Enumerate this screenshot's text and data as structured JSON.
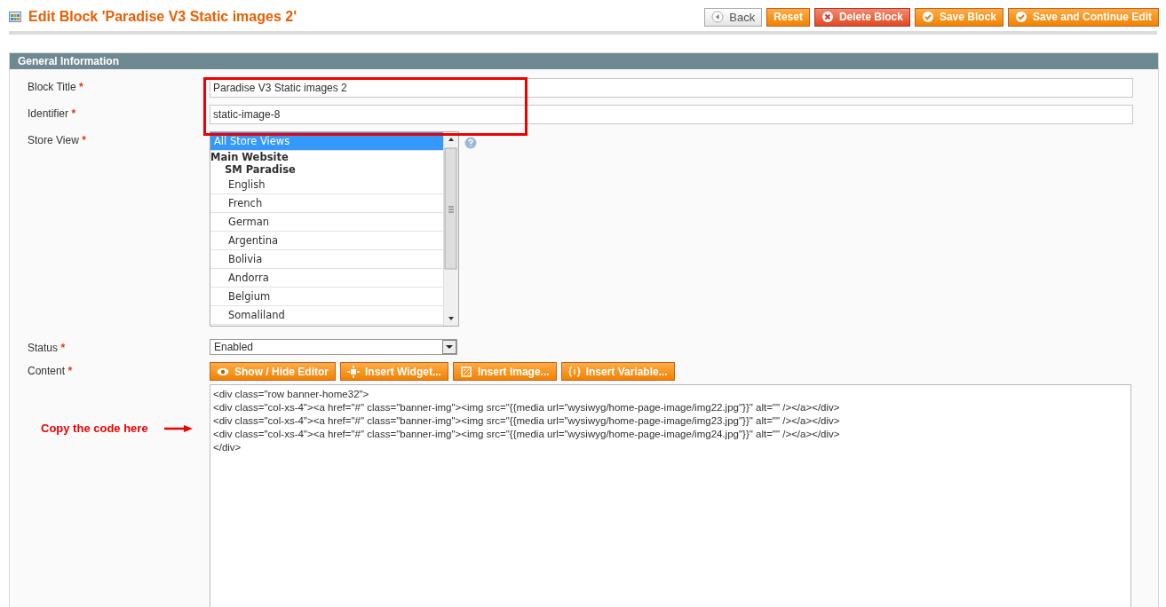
{
  "header": {
    "title": "Edit Block 'Paradise V3 Static images 2'",
    "buttons": [
      {
        "label": "Back",
        "kind": "back"
      },
      {
        "label": "Reset",
        "kind": "plain"
      },
      {
        "label": "Delete Block",
        "kind": "delete"
      },
      {
        "label": "Save Block",
        "kind": "save"
      },
      {
        "label": "Save and Continue Edit",
        "kind": "save"
      }
    ]
  },
  "section": {
    "title": "General Information"
  },
  "fields": [
    {
      "label": "Block Title",
      "mark": "*",
      "kind": "text",
      "value": "Paradise V3 Static images 2"
    },
    {
      "label": "Identifier",
      "mark": "*",
      "kind": "text",
      "value": "static-image-8"
    },
    {
      "label": "Store View",
      "mark": "*",
      "kind": "multiselect",
      "options": [
        {
          "label": "All Store Views",
          "kind": "option",
          "selected": true
        },
        {
          "label": "Main Website",
          "kind": "group",
          "selected": false
        },
        {
          "label": "SM Paradise",
          "kind": "subgroup",
          "selected": false
        },
        {
          "label": "English",
          "kind": "option",
          "selected": false
        },
        {
          "label": "French",
          "kind": "option",
          "selected": false
        },
        {
          "label": "German",
          "kind": "option",
          "selected": false
        },
        {
          "label": "Argentina",
          "kind": "option",
          "selected": false
        },
        {
          "label": "Bolivia",
          "kind": "option",
          "selected": false
        },
        {
          "label": "Andorra",
          "kind": "option",
          "selected": false
        },
        {
          "label": "Belgium",
          "kind": "option",
          "selected": false
        },
        {
          "label": "Somaliland",
          "kind": "option",
          "selected": false
        }
      ]
    },
    {
      "label": "Status",
      "mark": "*",
      "kind": "select",
      "value": "Enabled"
    },
    {
      "label": "Content",
      "mark": "*",
      "kind": "editor",
      "buttons": [
        {
          "label": "Show / Hide Editor",
          "kind": "eye"
        },
        {
          "label": "Insert Widget...",
          "kind": "widget"
        },
        {
          "label": "Insert Image...",
          "kind": "image"
        },
        {
          "label": "Insert Variable...",
          "kind": "variable"
        }
      ],
      "lines": [
        "<div class=\"row banner-home32\">",
        "<div class=\"col-xs-4\"><a href=\"#\" class=\"banner-img\"><img src=\"{{media url=\"wysiwyg/home-page-image/img22.jpg\"}}\" alt=\"\" /></a></div>",
        "<div class=\"col-xs-4\"><a href=\"#\" class=\"banner-img\"><img src=\"{{media url=\"wysiwyg/home-page-image/img23.jpg\"}}\" alt=\"\" /></a></div>",
        "<div class=\"col-xs-4\"><a href=\"#\" class=\"banner-img\"><img src=\"{{media url=\"wysiwyg/home-page-image/img24.jpg\"}}\" alt=\"\" /></a></div>",
        "</div>"
      ]
    }
  ],
  "annotation": {
    "text": "Copy the code here"
  }
}
